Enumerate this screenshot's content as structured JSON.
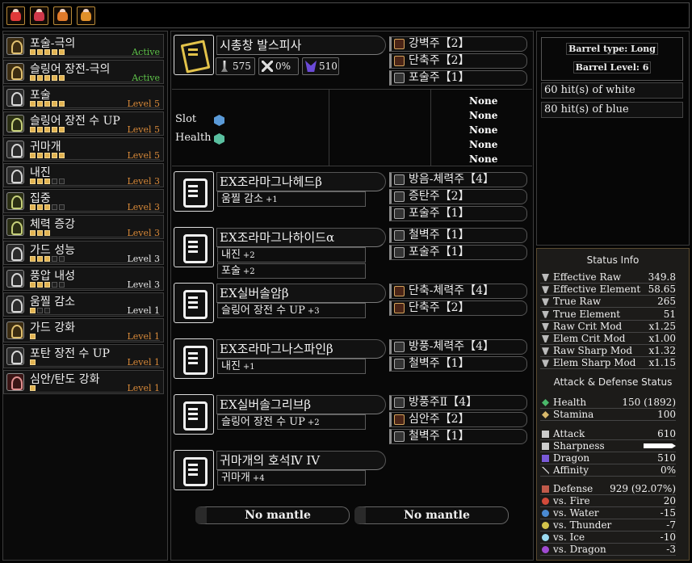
{
  "top_icons": [
    {
      "name": "guild-flag-icon-1",
      "color": "#e03a3a"
    },
    {
      "name": "guild-flag-icon-2",
      "color": "#d0384a"
    },
    {
      "name": "guild-flag-icon-3",
      "color": "#e07a2a"
    },
    {
      "name": "guild-flag-icon-4",
      "color": "#e0902a"
    }
  ],
  "skills": [
    {
      "name": "포술-극의",
      "level": "Active",
      "pips": [
        1,
        1,
        1,
        1,
        1
      ]
    },
    {
      "name": "슬링어 장전-극의",
      "level": "Active",
      "pips": [
        1,
        1,
        1,
        1,
        1
      ]
    },
    {
      "name": "포술",
      "level": "Level 5",
      "pips": [
        1,
        1,
        1,
        1,
        1
      ]
    },
    {
      "name": "슬링어 장전 수 UP",
      "level": "Level 5",
      "pips": [
        1,
        1,
        1,
        1,
        1
      ]
    },
    {
      "name": "귀마개",
      "level": "Level 5",
      "pips": [
        1,
        1,
        1,
        1,
        1
      ]
    },
    {
      "name": "내진",
      "level": "Level 3",
      "pips": [
        1,
        1,
        1,
        0,
        0
      ]
    },
    {
      "name": "집중",
      "level": "Level 3",
      "pips": [
        1,
        1,
        1,
        0,
        0
      ]
    },
    {
      "name": "체력 증강",
      "level": "Level 3",
      "pips": [
        1,
        1,
        1
      ]
    },
    {
      "name": "가드 성능",
      "level": "Level 3",
      "pips": [
        1,
        1,
        1,
        0,
        0
      ]
    },
    {
      "name": "풍압 내성",
      "level": "Level 3",
      "pips": [
        1,
        1,
        1,
        0,
        0
      ]
    },
    {
      "name": "움찔 감소",
      "level": "Level 1",
      "pips": [
        1,
        0,
        0
      ]
    },
    {
      "name": "가드 강화",
      "level": "Level 1",
      "pips": [
        1
      ]
    },
    {
      "name": "포탄 장전 수 UP",
      "level": "Level 1",
      "pips": [
        1
      ]
    },
    {
      "name": "심안/탄도 강화",
      "level": "Level 1",
      "pips": [
        1
      ]
    }
  ],
  "weapon": {
    "name": "시총창 발스피사",
    "raw": "575",
    "element": "0%",
    "dragon": "510",
    "decos": [
      "강벽주【2】",
      "단축주【2】",
      "포술주【1】"
    ],
    "slot_label": "Slot",
    "health_label": "Health",
    "none_values": [
      "None",
      "None",
      "None",
      "None",
      "None"
    ]
  },
  "armor": [
    {
      "name": "EX조라마그나헤드β",
      "skills": [
        {
          "name": "움찔 감소",
          "lv": "+1"
        }
      ],
      "decos": [
        "방음-체력주【4】",
        "증탄주【2】",
        "포술주【1】"
      ]
    },
    {
      "name": "EX조라마그나하이드α",
      "skills": [
        {
          "name": "내진",
          "lv": "+2"
        },
        {
          "name": "포술",
          "lv": "+2"
        }
      ],
      "decos": [
        "철벽주【1】",
        "포술주【1】"
      ]
    },
    {
      "name": "EX실버솔암β",
      "skills": [
        {
          "name": "슬링어 장전 수 UP",
          "lv": "+3"
        }
      ],
      "decos": [
        "단축-체력주【4】",
        "단축주【2】"
      ]
    },
    {
      "name": "EX조라마그나스파인β",
      "skills": [
        {
          "name": "내진",
          "lv": "+1"
        }
      ],
      "decos": [
        "방풍-체력주【4】",
        "철벽주【1】"
      ]
    },
    {
      "name": "EX실버솔그리브β",
      "skills": [
        {
          "name": "슬링어 장전 수 UP",
          "lv": "+2"
        }
      ],
      "decos": [
        "방풍주Ⅱ【4】",
        "심안주【2】",
        "철벽주【1】"
      ]
    },
    {
      "name": "귀마개의 호석Ⅳ IV",
      "skills": [
        {
          "name": "귀마개",
          "lv": "+4"
        }
      ],
      "decos": []
    }
  ],
  "mantles": [
    "No mantle",
    "No mantle"
  ],
  "barrel": {
    "type": "Barrel type: Long",
    "level": "Barrel Level: 6"
  },
  "hits": [
    "60 hit(s) of white",
    "80 hit(s) of blue"
  ],
  "status_info": {
    "title": "Status Info",
    "rows": [
      {
        "k": "Effective Raw",
        "v": "349.8"
      },
      {
        "k": "Effective Element",
        "v": "58.65"
      },
      {
        "k": "True Raw",
        "v": "265"
      },
      {
        "k": "True Element",
        "v": "51"
      },
      {
        "k": "Raw Crit Mod",
        "v": "x1.25"
      },
      {
        "k": "Elem Crit Mod",
        "v": "x1.00"
      },
      {
        "k": "Raw Sharp Mod",
        "v": "x1.32"
      },
      {
        "k": "Elem Sharp Mod",
        "v": "x1.15"
      }
    ]
  },
  "attack_defense": {
    "title": "Attack & Defense Status",
    "health": {
      "k": "Health",
      "v": "150 (1892)"
    },
    "stamina": {
      "k": "Stamina",
      "v": "100"
    },
    "attack": {
      "k": "Attack",
      "v": "610"
    },
    "sharpness": {
      "k": "Sharpness"
    },
    "dragon": {
      "k": "Dragon",
      "v": "510"
    },
    "affinity": {
      "k": "Affinity",
      "v": "0%"
    },
    "defense": {
      "k": "Defense",
      "v": "929 (92.07%)"
    },
    "resists": [
      {
        "k": "vs. Fire",
        "v": "20",
        "c": "#d24a3a"
      },
      {
        "k": "vs. Water",
        "v": "-15",
        "c": "#4a8ad2"
      },
      {
        "k": "vs. Thunder",
        "v": "-7",
        "c": "#d2c24a"
      },
      {
        "k": "vs. Ice",
        "v": "-10",
        "c": "#9adaf0"
      },
      {
        "k": "vs. Dragon",
        "v": "-3",
        "c": "#a04ad2"
      }
    ]
  }
}
